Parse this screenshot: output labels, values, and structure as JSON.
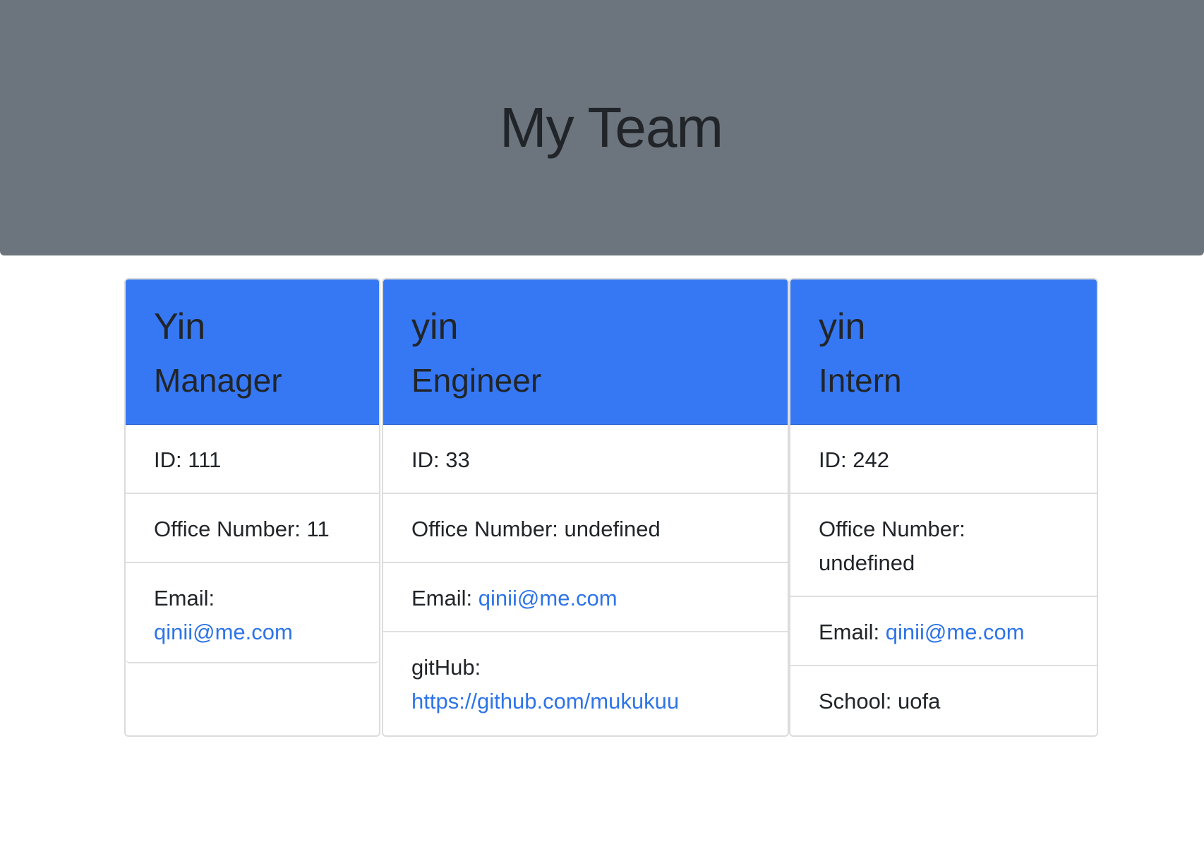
{
  "header": {
    "title": "My Team"
  },
  "colors": {
    "jumbotron": "#6c757d",
    "card_header": "#3678f4",
    "link": "#2e74e8"
  },
  "cards": [
    {
      "name": "Yin",
      "role": "Manager",
      "id_text": "ID: 111",
      "office_text": "Office Number: 11",
      "email_label": "Email:",
      "email": "qinii@me.com"
    },
    {
      "name": "yin",
      "role": "Engineer",
      "id_text": "ID: 33",
      "office_text": "Office Number: undefined",
      "email_label": "Email:",
      "email": "qinii@me.com",
      "github_label": "gitHub:",
      "github": "https://github.com/mukukuu"
    },
    {
      "name": "yin",
      "role": "Intern",
      "id_text": "ID: 242",
      "office_text": "Office Number: undefined",
      "email_label": "Email:",
      "email": "qinii@me.com",
      "school_text": "School: uofa"
    }
  ]
}
